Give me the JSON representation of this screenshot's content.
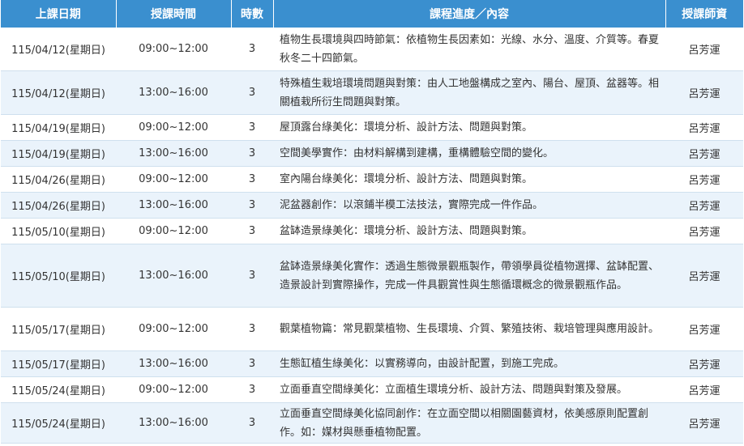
{
  "headers": {
    "date": "上課日期",
    "time": "授課時間",
    "hours": "時數",
    "content": "課程進度／內容",
    "teacher": "授課師資"
  },
  "rows": [
    {
      "date": "115/04/12(星期日)",
      "time": "09:00~12:00",
      "hours": "3",
      "content": "植物生長環境與四時節氣：依植物生長因素如：光線、水分、溫度、介質等。春夏秋冬二十四節氣。",
      "teacher": "呂芳運"
    },
    {
      "date": "115/04/12(星期日)",
      "time": "13:00~16:00",
      "hours": "3",
      "content": "特殊植生栽培環境問題與對策：由人工地盤構成之室內、陽台、屋頂、盆器等。相關植栽所衍生問題與對策。",
      "teacher": "呂芳運"
    },
    {
      "date": "115/04/19(星期日)",
      "time": "09:00~12:00",
      "hours": "3",
      "content": "屋頂露台綠美化：環境分析、設計方法、問題與對策。",
      "teacher": "呂芳運"
    },
    {
      "date": "115/04/19(星期日)",
      "time": "13:00~16:00",
      "hours": "3",
      "content": "空間美學實作：由材料解構到建構，重構體驗空間的變化。",
      "teacher": "呂芳運"
    },
    {
      "date": "115/04/26(星期日)",
      "time": "09:00~12:00",
      "hours": "3",
      "content": "室內陽台綠美化：環境分析、設計方法、問題與對策。",
      "teacher": "呂芳運"
    },
    {
      "date": "115/04/26(星期日)",
      "time": "13:00~16:00",
      "hours": "3",
      "content": "泥盆器創作：以滾鋪半模工法技法，實際完成一件作品。",
      "teacher": "呂芳運"
    },
    {
      "date": "115/05/10(星期日)",
      "time": "09:00~12:00",
      "hours": "3",
      "content": "盆缽造景綠美化：環境分析、設計方法、問題與對策。",
      "teacher": "呂芳運"
    },
    {
      "date": "115/05/10(星期日)",
      "time": "13:00~16:00",
      "hours": "3",
      "content": "盆缽造景綠美化實作：透過生態微景觀瓶製作，帶領學員從植物選擇、盆缽配置、造景設計到實際操作，完成一件具觀賞性與生態循環概念的微景觀瓶作品。",
      "teacher": "呂芳運"
    },
    {
      "date": "115/05/17(星期日)",
      "time": "09:00~12:00",
      "hours": "3",
      "content": "觀葉植物篇：常見觀葉植物、生長環境、介質、繁殖技術、栽培管理與應用設計。",
      "teacher": "呂芳運"
    },
    {
      "date": "115/05/17(星期日)",
      "time": "13:00~16:00",
      "hours": "3",
      "content": "生態缸植生綠美化：以實務導向，由設計配置，到施工完成。",
      "teacher": "呂芳運"
    },
    {
      "date": "115/05/24(星期日)",
      "time": "09:00~12:00",
      "hours": "3",
      "content": "立面垂直空間綠美化：立面植生環境分析、設計方法、問題與對策及發展。",
      "teacher": "呂芳運"
    },
    {
      "date": "115/05/24(星期日)",
      "time": "13:00~16:00",
      "hours": "3",
      "content": "立面垂直空間綠美化協同創作：在立面空間以相關園藝資材，依美感原則配置創作。如：媒材與懸垂植物配置。",
      "teacher": "呂芳運"
    }
  ]
}
